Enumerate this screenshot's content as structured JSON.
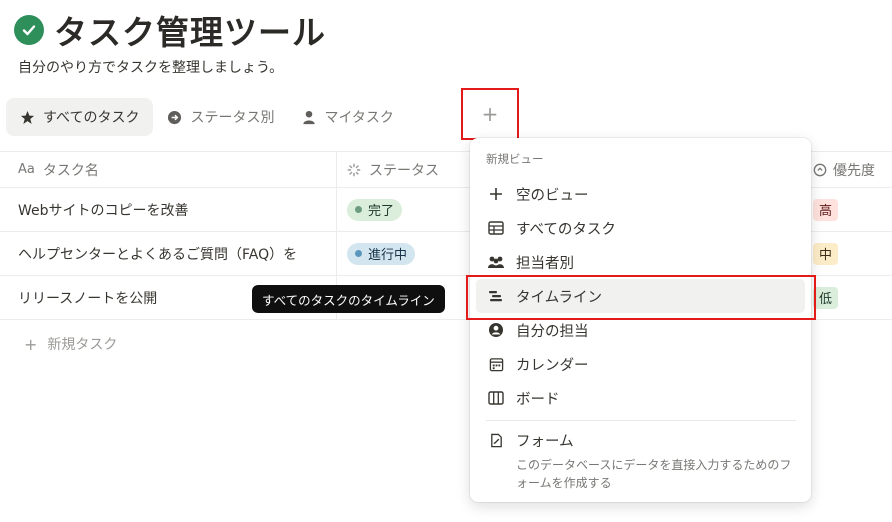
{
  "page": {
    "title": "タスク管理ツール",
    "subtitle": "自分のやり方でタスクを整理しましょう。"
  },
  "tabs": [
    {
      "label": "すべてのタスク",
      "icon": "star-icon"
    },
    {
      "label": "ステータス別",
      "icon": "arrow-circle-icon"
    },
    {
      "label": "マイタスク",
      "icon": "person-icon"
    }
  ],
  "add_view_label": "+",
  "table": {
    "headers": {
      "name_prefix": "Aa",
      "name": "タスク名",
      "status": "ステータス",
      "priority": "優先度"
    },
    "rows": [
      {
        "name": "Webサイトのコピーを改善",
        "status": "完了",
        "priority": "高"
      },
      {
        "name": "ヘルプセンターとよくあるご質問（FAQ）を",
        "status": "進行中",
        "priority": "中"
      },
      {
        "name": "リリースノートを公開",
        "status": "",
        "priority": "低"
      }
    ],
    "new_task_label": "新規タスク"
  },
  "tooltip": "すべてのタスクのタイムライン",
  "menu": {
    "header": "新規ビュー",
    "items": [
      {
        "label": "空のビュー",
        "icon": "plus-icon"
      },
      {
        "label": "すべてのタスク",
        "icon": "table-icon"
      },
      {
        "label": "担当者別",
        "icon": "people-icon"
      },
      {
        "label": "タイムライン",
        "icon": "timeline-icon"
      },
      {
        "label": "自分の担当",
        "icon": "user-circle-icon"
      },
      {
        "label": "カレンダー",
        "icon": "calendar-icon"
      },
      {
        "label": "ボード",
        "icon": "board-icon"
      }
    ],
    "form": {
      "label": "フォーム",
      "description": "このデータベースにデータを直接入力するためのフォームを作成する",
      "icon": "form-icon"
    }
  },
  "colors": {
    "accent_green": "#2f8f5b",
    "highlight_red": "#e31a1a"
  }
}
